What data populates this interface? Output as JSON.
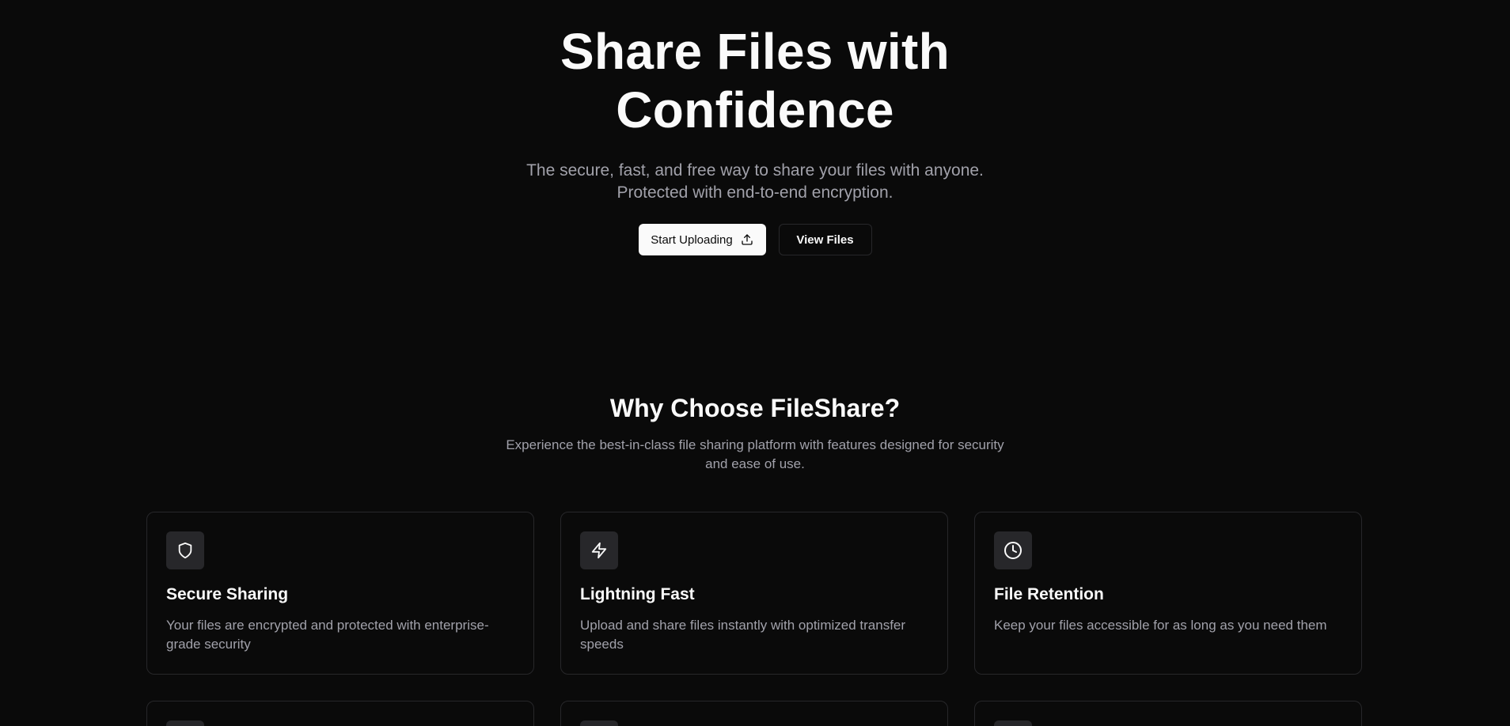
{
  "hero": {
    "title_line1": "Share Files with",
    "title_line2": "Confidence",
    "subtitle_line1": "The secure, fast, and free way to share your files with anyone.",
    "subtitle_line2": "Protected with end-to-end encryption.",
    "primary_button_label": "Start Uploading",
    "primary_button_icon": "upload-icon",
    "secondary_button_label": "View Files"
  },
  "why": {
    "title": "Why Choose FileShare?",
    "subtitle_line1": "Experience the best-in-class file sharing platform with features designed for security",
    "subtitle_line2": "and ease of use."
  },
  "features": [
    {
      "icon": "shield-icon",
      "title": "Secure Sharing",
      "description": "Your files are encrypted and protected with enterprise-grade security"
    },
    {
      "icon": "lightning-icon",
      "title": "Lightning Fast",
      "description": "Upload and share files instantly with optimized transfer speeds"
    },
    {
      "icon": "clock-icon",
      "title": "File Retention",
      "description": "Keep your files accessible for as long as you need them"
    }
  ],
  "colors": {
    "background": "#0a0a0a",
    "foreground": "#fafafa",
    "muted_text": "#a1a1aa",
    "border": "#27272a",
    "icon_box": "#27272a"
  }
}
